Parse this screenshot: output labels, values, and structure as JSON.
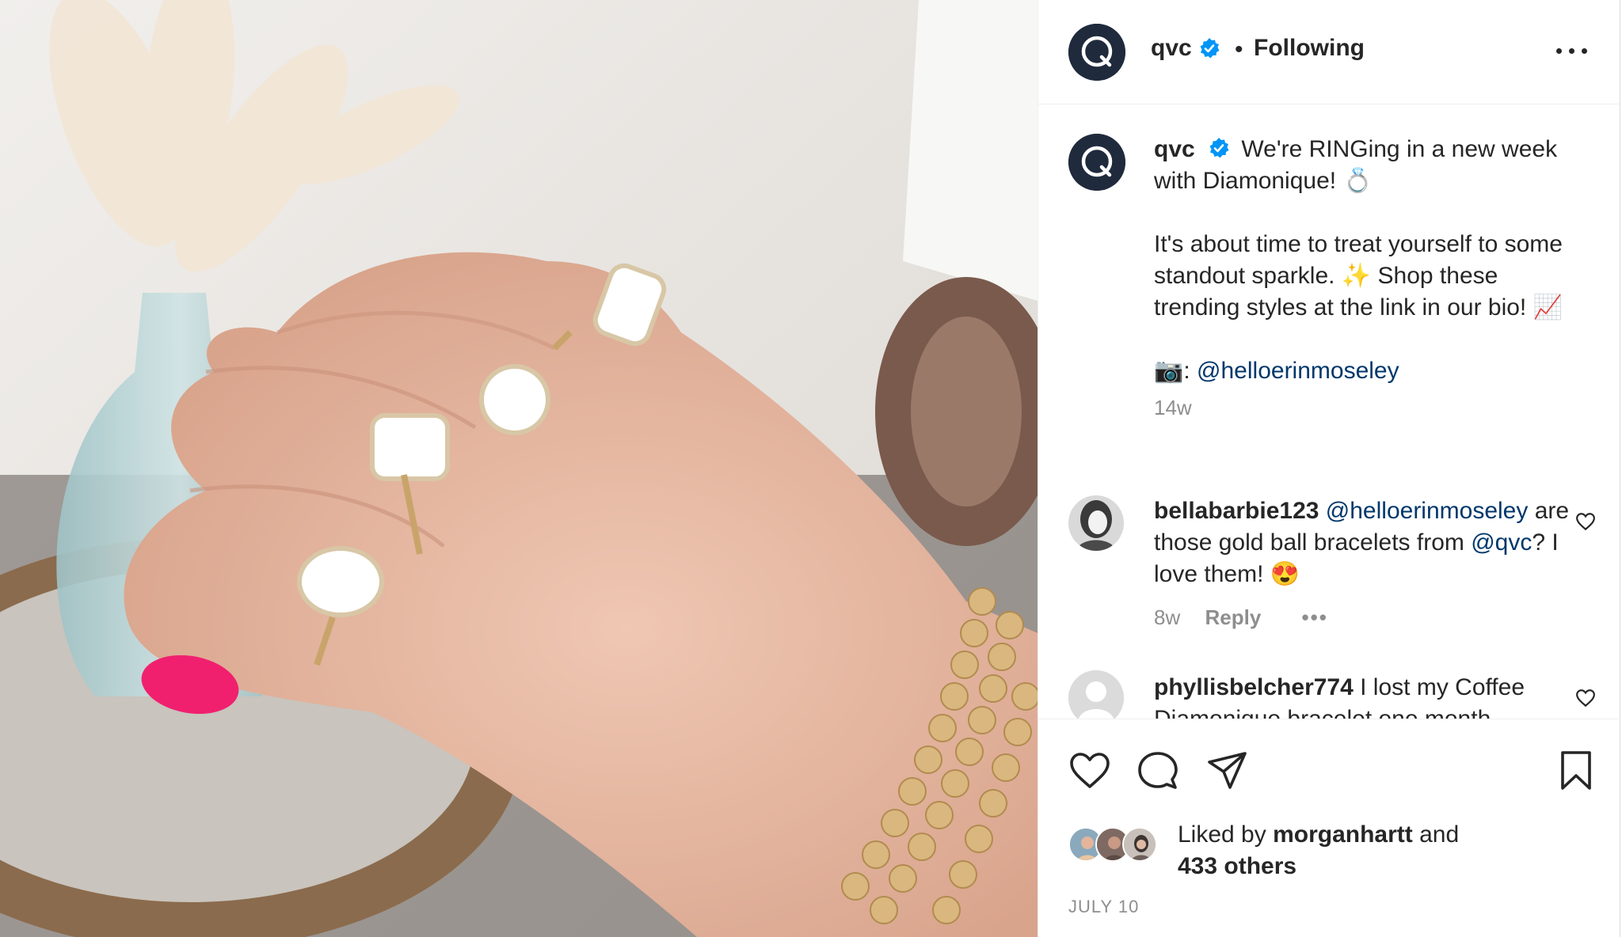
{
  "header": {
    "username": "qvc",
    "separator": "•",
    "follow_label": "Following"
  },
  "caption": {
    "username": "qvc",
    "line1": "We're RINGing in a new week with Diamonique!",
    "line1_emoji": "💍",
    "para2_part1": "It's about time to treat yourself to some standout sparkle.",
    "para2_emoji1": "✨",
    "para2_part2": "Shop these trending styles at the link in our bio!",
    "para2_emoji2": "📈",
    "credit_emoji": "📷",
    "credit_sep": ":",
    "credit_mention": "@helloerinmoseley",
    "time": "14w"
  },
  "comments": [
    {
      "username": "bellabarbie123",
      "mention1": "@helloerinmoseley",
      "text1": "are those gold ball bracelets from",
      "mention2": "@qvc",
      "text2": "? I love them!",
      "emoji": "😍",
      "time": "8w",
      "reply_label": "Reply",
      "more_label": "•••"
    },
    {
      "username": "phyllisbelcher774",
      "text": "I lost my Coffee",
      "text_cut": "Diamonique bracelet one month"
    }
  ],
  "likes": {
    "prefix": "Liked by",
    "user": "morganhartt",
    "connector": "and",
    "others": "433 others"
  },
  "date": "JULY 10",
  "icons": {
    "like": "heart-icon",
    "comment": "comment-icon",
    "share": "send-icon",
    "save": "bookmark-icon",
    "verified": "verified-badge-icon"
  },
  "colors": {
    "text": "#262626",
    "muted": "#8e8e8e",
    "mention": "#00376b",
    "verified": "#0095f6",
    "brand_avatar": "#1f2a3c"
  }
}
